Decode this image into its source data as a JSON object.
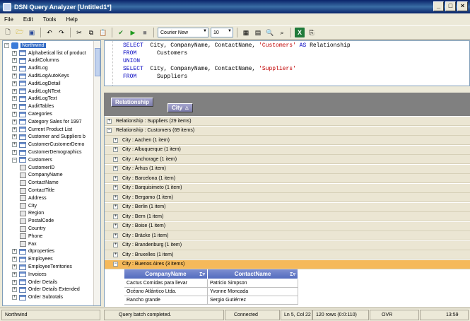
{
  "window": {
    "title": "DSN Query Analyzer [Untitled1*]",
    "min": "_",
    "max": "□",
    "close": "×"
  },
  "menu": [
    "File",
    "Edit",
    "Tools",
    "Help"
  ],
  "toolbar": {
    "font": "Courier New",
    "size": "10"
  },
  "tree": {
    "root": "Northwind",
    "items_before": [
      "Alphabetical list of product",
      "AuditColumns",
      "AuditLog",
      "AuditLogAutoKeys",
      "AuditLogDetail",
      "AuditLogNText",
      "AuditLogText",
      "AuditTables",
      "Categories",
      "Category Sales for 1997",
      "Current Product List",
      "Customer and Suppliers b",
      "CustomerCustomerDemo",
      "CustomerDemographics"
    ],
    "expanded": "Customers",
    "columns": [
      "CustomerID",
      "CompanyName",
      "ContactName",
      "ContactTitle",
      "Address",
      "City",
      "Region",
      "PostalCode",
      "Country",
      "Phone",
      "Fax"
    ],
    "items_after": [
      "dtproperties",
      "Employees",
      "EmployeeTerritories",
      "Invoices",
      "Order Details",
      "Order Details Extended",
      "Order Subtotals"
    ]
  },
  "sql": {
    "select1": "SELECT",
    "cols1": "  City, CompanyName, ContactName, ",
    "str1": "'Customers'",
    "as": " AS ",
    "alias": "Relationship",
    "from1": "FROM",
    "tbl1": "      Customers",
    "union": "UNION",
    "select2": "SELECT",
    "cols2": "  City, CompanyName, ContactName, ",
    "str2": "'Suppliers'",
    "from2": "FROM",
    "tbl2": "      Suppliers"
  },
  "groupby": {
    "g1": "Relationship",
    "g2": "City"
  },
  "grid": {
    "groups": [
      "Relationship : Suppliers (29 items)",
      "Relationship : Customers (69 items)"
    ],
    "cities": [
      "City : Aachen (1 item)",
      "City : Albuquerque (1 item)",
      "City : Anchorage (1 item)",
      "City : Århus (1 item)",
      "City : Barcelona (1 item)",
      "City : Barquisimeto (1 item)",
      "City : Bergamo (1 item)",
      "City : Berlin (1 item)",
      "City : Bern (1 item)",
      "City : Boise (1 item)",
      "City : Bräcke (1 item)",
      "City : Brandenburg (1 item)",
      "City : Bruxelles (1 item)",
      "City : Buenos Aires (3 items)"
    ],
    "headers": [
      "CompanyName",
      "ContactName"
    ],
    "rows": [
      [
        "Cactus Comidas para llevar",
        "Patricio Simpson"
      ],
      [
        "Océano Atlántico Ltda.",
        "Yvonne Moncada"
      ],
      [
        "Rancho grande",
        "Sergio Gutiérrez"
      ]
    ]
  },
  "status": {
    "db": "Northwind",
    "msg": "Query batch completed.",
    "conn": "Connected",
    "pos": "Ln 5, Col 22",
    "rows": "120 rows (0:0:110)",
    "ovr": "OVR",
    "time": "13:59"
  }
}
